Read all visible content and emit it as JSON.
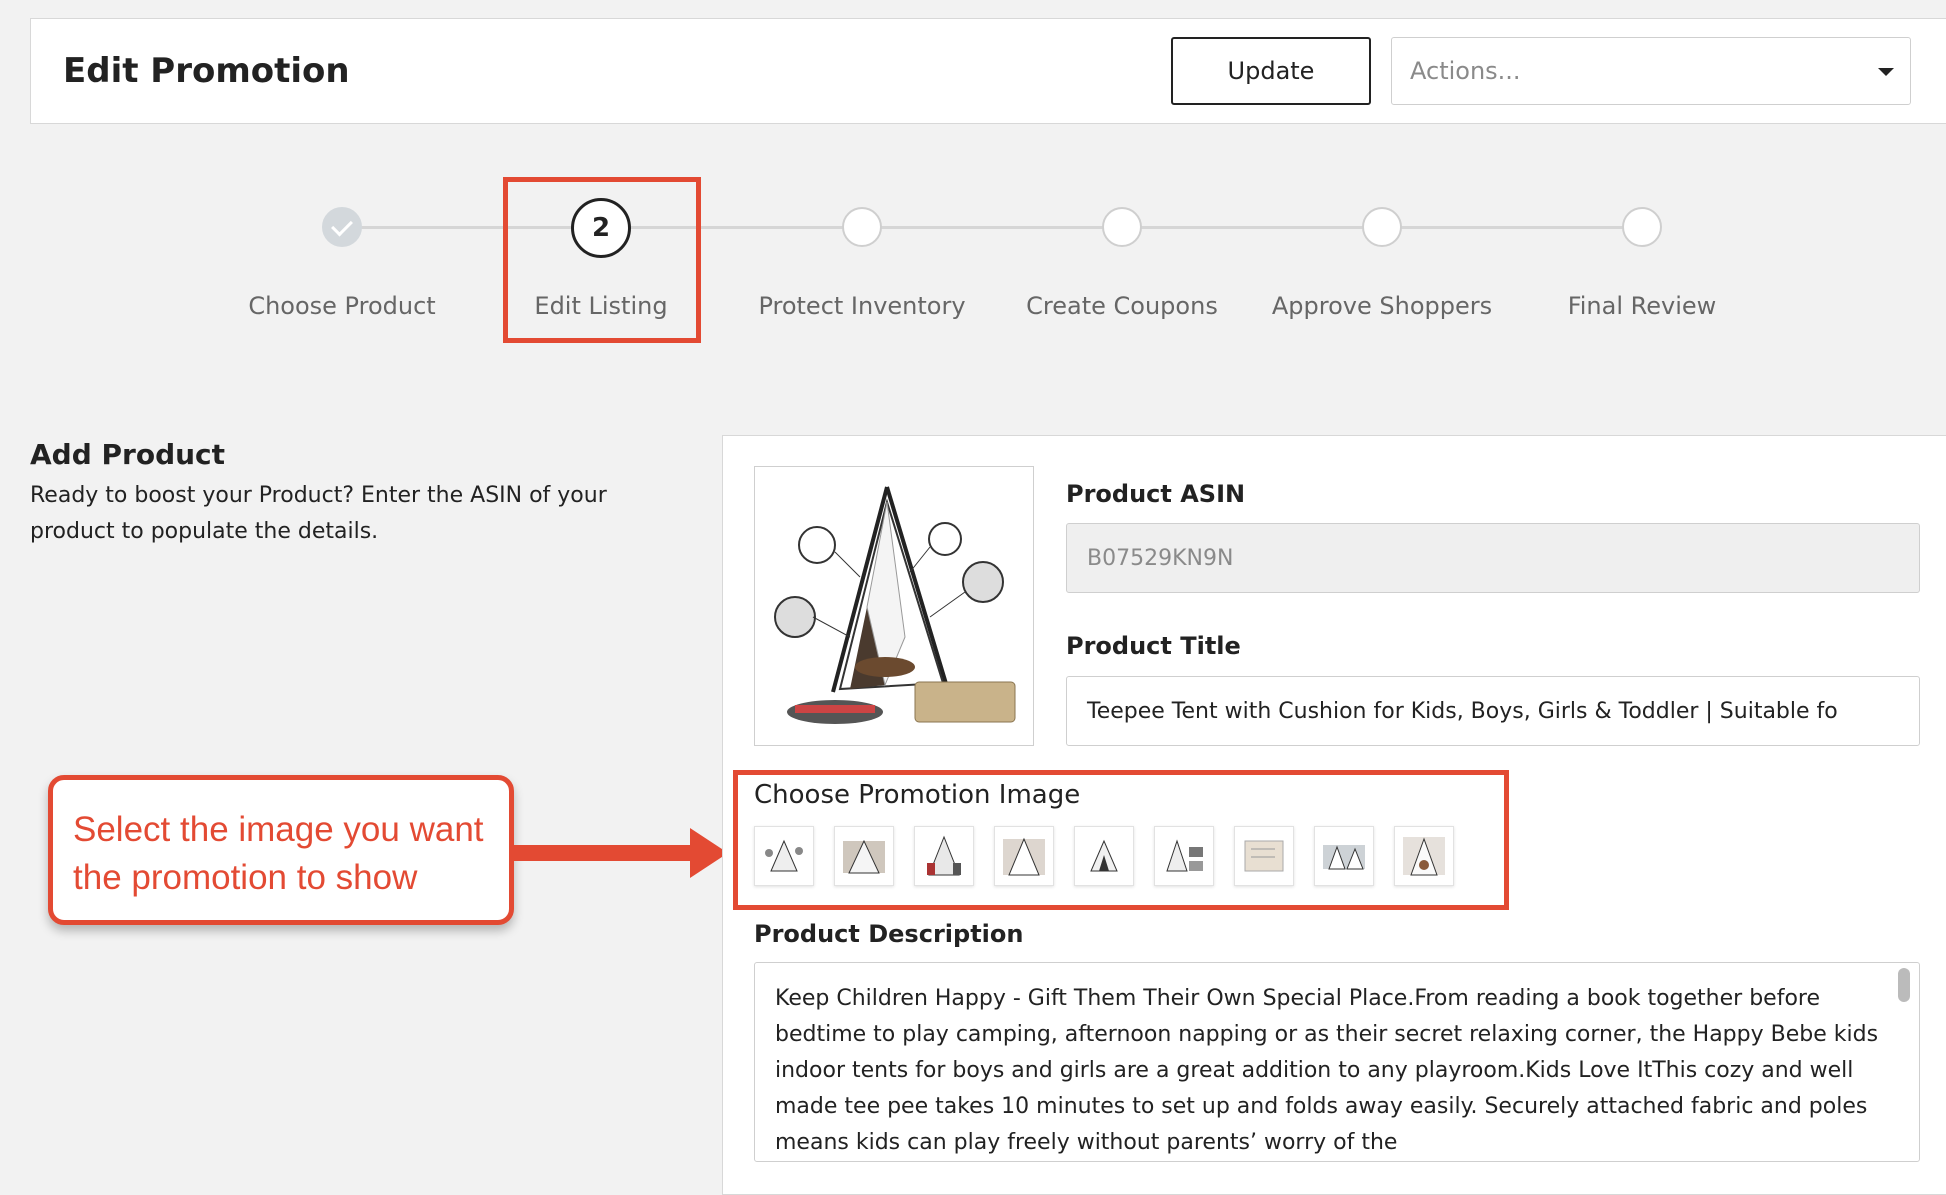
{
  "header": {
    "title": "Edit Promotion",
    "update_label": "Update",
    "actions_placeholder": "Actions..."
  },
  "stepper": {
    "steps": [
      {
        "label": "Choose Product",
        "state": "done"
      },
      {
        "label": "Edit Listing",
        "state": "active",
        "number": "2"
      },
      {
        "label": "Protect Inventory",
        "state": "pending"
      },
      {
        "label": "Create Coupons",
        "state": "pending"
      },
      {
        "label": "Approve Shoppers",
        "state": "pending"
      },
      {
        "label": "Final Review",
        "state": "pending"
      }
    ]
  },
  "intro": {
    "title": "Add Product",
    "description": "Ready to boost your Product? Enter the ASIN of your product to populate the details."
  },
  "callout": {
    "text": "Select the image you want the promotion to show"
  },
  "product": {
    "asin_label": "Product ASIN",
    "asin_value": "B07529KN9N",
    "title_label": "Product Title",
    "title_value": "Teepee Tent with Cushion for Kids, Boys, Girls & Toddler | Suitable fo",
    "promo_image_label": "Choose Promotion Image",
    "thumbnail_count": 9,
    "description_label": "Product Description",
    "description_value": "Keep Children Happy - Gift Them Their Own Special Place.From reading a book together before bedtime to play camping, afternoon napping or as their secret relaxing corner, the Happy Bebe kids indoor tents for boys and girls are a great addition to any playroom.Kids Love ItThis cozy and well made tee pee takes 10 minutes to set up and folds away easily. Securely attached fabric and poles means kids can play freely without parents’ worry of the"
  },
  "colors": {
    "highlight": "#e34a33",
    "background": "#f2f2f2"
  }
}
